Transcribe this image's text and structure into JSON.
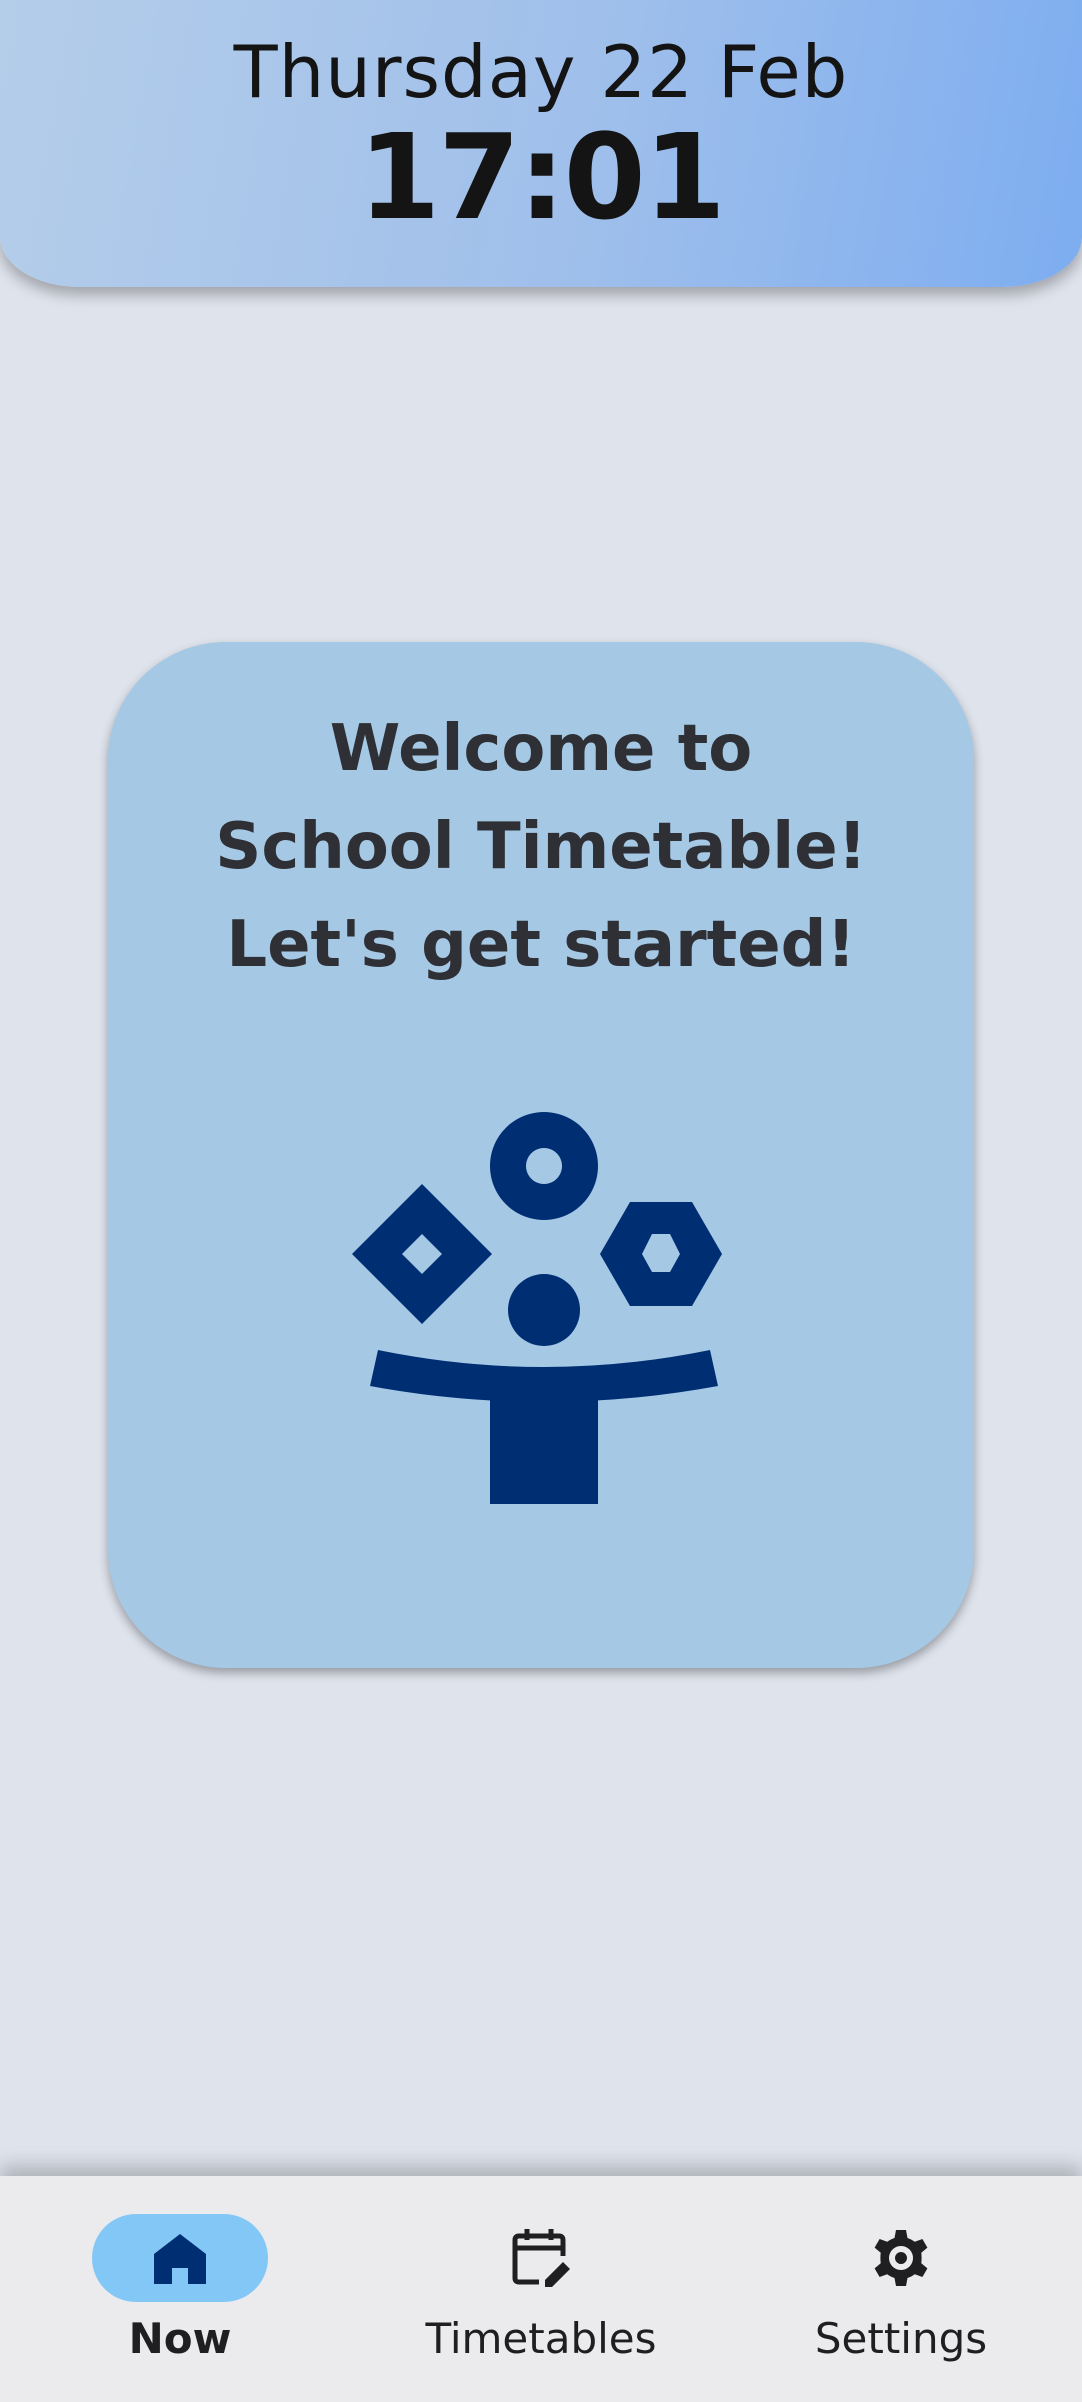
{
  "header": {
    "date": "Thursday 22 Feb",
    "time": "17:01"
  },
  "welcome_card": {
    "lines": [
      "Welcome to",
      "School Timetable!",
      "Let's get started!"
    ],
    "illustration_icon": "person-juggling-shapes-icon"
  },
  "bottom_nav": {
    "items": [
      {
        "label": "Now",
        "icon": "home-icon",
        "active": true
      },
      {
        "label": "Timetables",
        "icon": "calendar-edit-icon",
        "active": false
      },
      {
        "label": "Settings",
        "icon": "gear-icon",
        "active": false
      }
    ]
  },
  "colors": {
    "header_gradient_start": "#b4cde9",
    "header_gradient_end": "#7dadf0",
    "background": "#dfe3ec",
    "card": "#a5c8e5",
    "illustration": "#002e73",
    "nav_active_pill": "#83c7f7",
    "nav_background": "#ebebed"
  }
}
